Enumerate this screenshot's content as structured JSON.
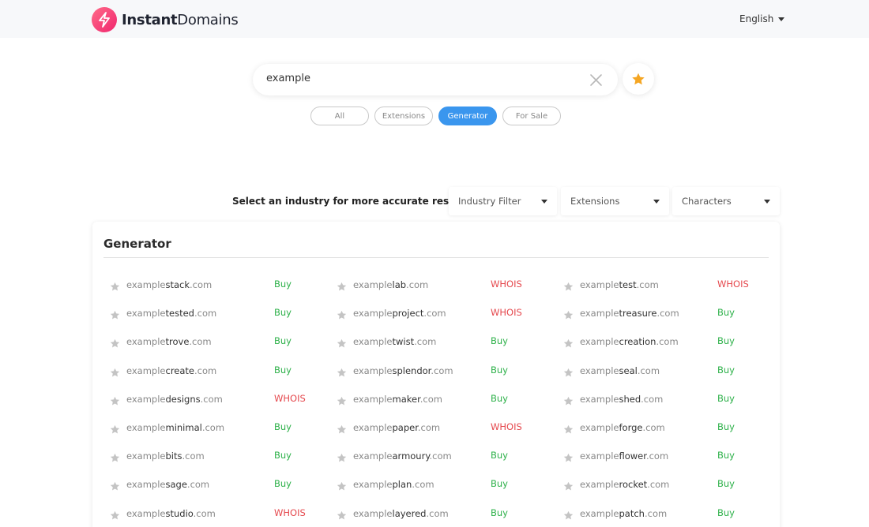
{
  "brand": {
    "bold": "Instant",
    "light": "Domains"
  },
  "language": "English",
  "search": {
    "value": "example",
    "placeholder": ""
  },
  "tabs": [
    {
      "label": "All",
      "active": false
    },
    {
      "label": "Extensions",
      "active": false
    },
    {
      "label": "Generator",
      "active": true
    },
    {
      "label": "For Sale",
      "active": false
    }
  ],
  "filters": {
    "label": "Select an industry for more accurate results",
    "industry": "Industry Filter",
    "extensions": "Extensions",
    "characters": "Characters"
  },
  "section": {
    "title": "Generator"
  },
  "results": [
    [
      {
        "prefix": "example",
        "word": "stack",
        "tld": ".com",
        "action": "Buy"
      },
      {
        "prefix": "example",
        "word": "tested",
        "tld": ".com",
        "action": "Buy"
      },
      {
        "prefix": "example",
        "word": "trove",
        "tld": ".com",
        "action": "Buy"
      },
      {
        "prefix": "example",
        "word": "create",
        "tld": ".com",
        "action": "Buy"
      },
      {
        "prefix": "example",
        "word": "designs",
        "tld": ".com",
        "action": "WHOIS"
      },
      {
        "prefix": "example",
        "word": "minimal",
        "tld": ".com",
        "action": "Buy"
      },
      {
        "prefix": "example",
        "word": "bits",
        "tld": ".com",
        "action": "Buy"
      },
      {
        "prefix": "example",
        "word": "sage",
        "tld": ".com",
        "action": "Buy"
      },
      {
        "prefix": "example",
        "word": "studio",
        "tld": ".com",
        "action": "WHOIS"
      }
    ],
    [
      {
        "prefix": "example",
        "word": "lab",
        "tld": ".com",
        "action": "WHOIS"
      },
      {
        "prefix": "example",
        "word": "project",
        "tld": ".com",
        "action": "WHOIS"
      },
      {
        "prefix": "example",
        "word": "twist",
        "tld": ".com",
        "action": "Buy"
      },
      {
        "prefix": "example",
        "word": "splendor",
        "tld": ".com",
        "action": "Buy"
      },
      {
        "prefix": "example",
        "word": "maker",
        "tld": ".com",
        "action": "Buy"
      },
      {
        "prefix": "example",
        "word": "paper",
        "tld": ".com",
        "action": "WHOIS"
      },
      {
        "prefix": "example",
        "word": "armoury",
        "tld": ".com",
        "action": "Buy"
      },
      {
        "prefix": "example",
        "word": "plan",
        "tld": ".com",
        "action": "Buy"
      },
      {
        "prefix": "example",
        "word": "layered",
        "tld": ".com",
        "action": "Buy"
      }
    ],
    [
      {
        "prefix": "example",
        "word": "test",
        "tld": ".com",
        "action": "WHOIS"
      },
      {
        "prefix": "example",
        "word": "treasure",
        "tld": ".com",
        "action": "Buy"
      },
      {
        "prefix": "example",
        "word": "creation",
        "tld": ".com",
        "action": "Buy"
      },
      {
        "prefix": "example",
        "word": "seal",
        "tld": ".com",
        "action": "Buy"
      },
      {
        "prefix": "example",
        "word": "shed",
        "tld": ".com",
        "action": "Buy"
      },
      {
        "prefix": "example",
        "word": "forge",
        "tld": ".com",
        "action": "Buy"
      },
      {
        "prefix": "example",
        "word": "flower",
        "tld": ".com",
        "action": "Buy"
      },
      {
        "prefix": "example",
        "word": "rocket",
        "tld": ".com",
        "action": "Buy"
      },
      {
        "prefix": "example",
        "word": "patch",
        "tld": ".com",
        "action": "Buy"
      }
    ]
  ],
  "colors": {
    "accent": "#3a96ee",
    "buy": "#2eb14a",
    "whois": "#e5484d",
    "favorite_star": "#f5a623",
    "brand": "#f0266e"
  },
  "icons": {
    "logo": "lightning-bolt-icon",
    "clear": "close-icon",
    "favorites": "star-icon",
    "result_favorite": "star-icon",
    "dropdown": "chevron-down-icon"
  }
}
